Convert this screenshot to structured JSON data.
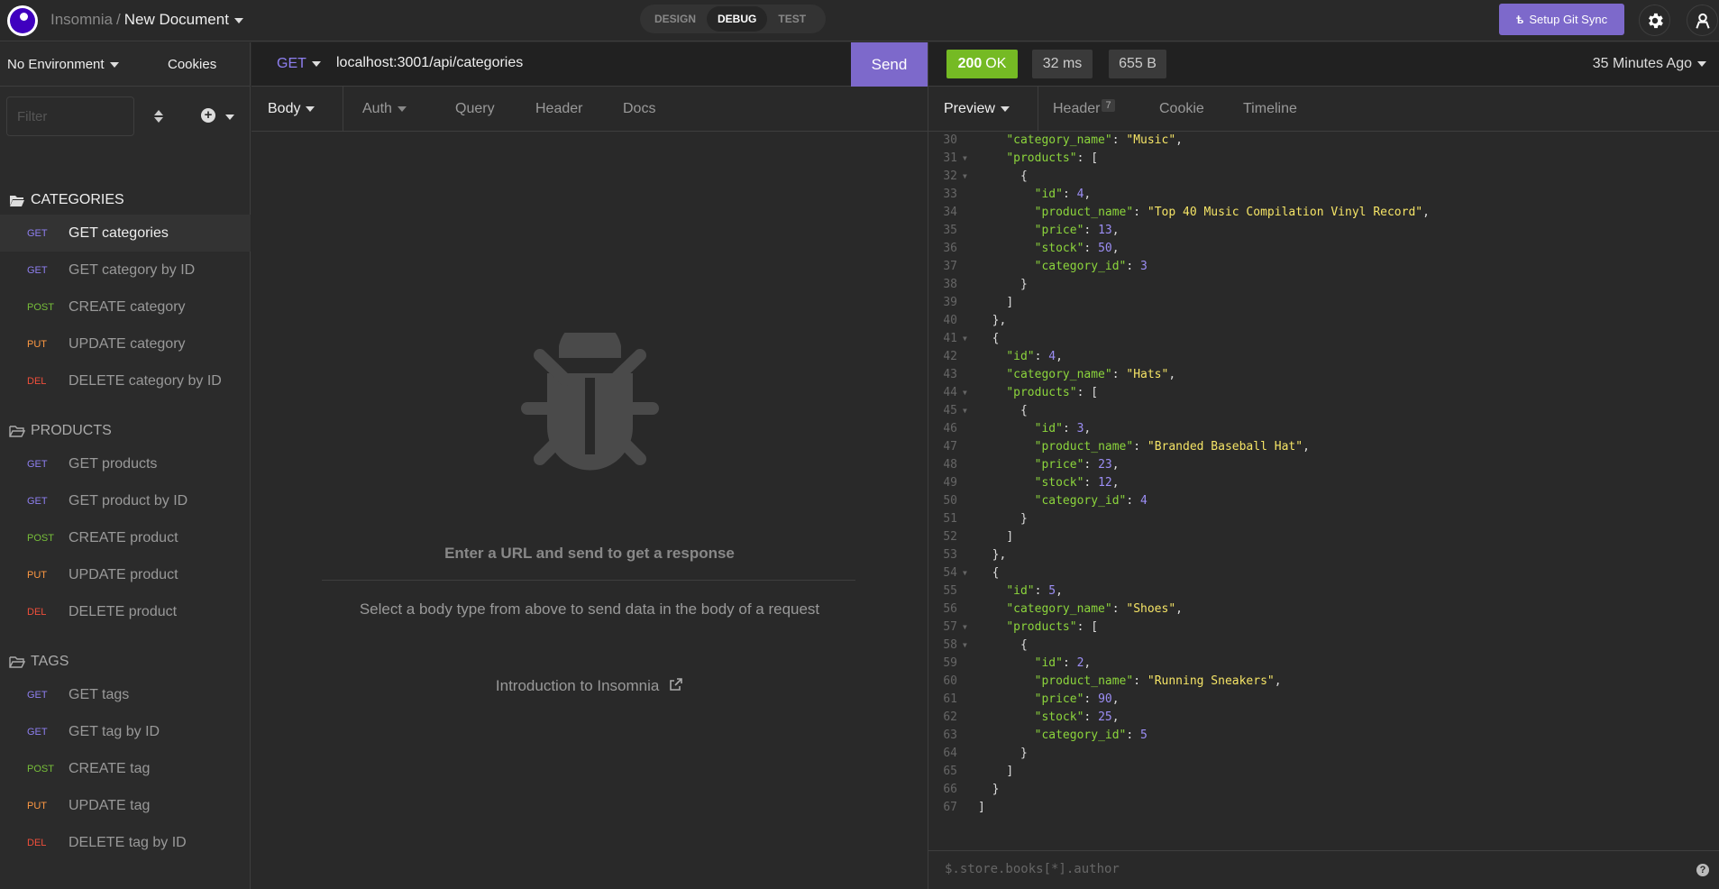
{
  "app": {
    "name": "Insomnia",
    "separator": "/",
    "document": "New Document",
    "modes": [
      "DESIGN",
      "DEBUG",
      "TEST"
    ],
    "active_mode": "DEBUG",
    "git_sync_label": "Setup Git Sync",
    "settings_icon": "gear-icon",
    "account_icon": "user-icon"
  },
  "sidebar": {
    "environment": "No Environment",
    "cookies_label": "Cookies",
    "filter_placeholder": "Filter",
    "folders": [
      {
        "name": "CATEGORIES",
        "open": true,
        "requests": [
          {
            "method": "GET",
            "name": "GET categories",
            "active": true
          },
          {
            "method": "GET",
            "name": "GET category by ID"
          },
          {
            "method": "POST",
            "name": "CREATE category"
          },
          {
            "method": "PUT",
            "name": "UPDATE category"
          },
          {
            "method": "DEL",
            "name": "DELETE category by ID"
          }
        ]
      },
      {
        "name": "PRODUCTS",
        "open": false,
        "requests": [
          {
            "method": "GET",
            "name": "GET products"
          },
          {
            "method": "GET",
            "name": "GET product by ID"
          },
          {
            "method": "POST",
            "name": "CREATE product"
          },
          {
            "method": "PUT",
            "name": "UPDATE product"
          },
          {
            "method": "DEL",
            "name": "DELETE product"
          }
        ]
      },
      {
        "name": "TAGS",
        "open": false,
        "requests": [
          {
            "method": "GET",
            "name": "GET tags"
          },
          {
            "method": "GET",
            "name": "GET tag by ID"
          },
          {
            "method": "POST",
            "name": "CREATE tag"
          },
          {
            "method": "PUT",
            "name": "UPDATE tag"
          },
          {
            "method": "DEL",
            "name": "DELETE tag by ID"
          }
        ]
      }
    ]
  },
  "request": {
    "method": "GET",
    "url": "localhost:3001/api/categories",
    "send_label": "Send",
    "tabs": [
      "Body",
      "Auth",
      "Query",
      "Header",
      "Docs"
    ],
    "empty_title": "Enter a URL and send to get a response",
    "empty_subtitle": "Select a body type from above to send data in the body of a request",
    "intro_link": "Introduction to Insomnia"
  },
  "response": {
    "status_code": "200",
    "status_text": "OK",
    "time": "32 ms",
    "size": "655 B",
    "age": "35 Minutes Ago",
    "tabs": [
      "Preview",
      "Header",
      "Cookie",
      "Timeline"
    ],
    "header_count": "7",
    "filter_placeholder": "$.store.books[*].author",
    "lines": [
      {
        "n": 30,
        "indent": 2,
        "key": "category_name",
        "str": "Music",
        "end": ","
      },
      {
        "n": 31,
        "indent": 2,
        "key": "products",
        "raw": "[",
        "fold": true
      },
      {
        "n": 32,
        "indent": 3,
        "raw": "{",
        "fold": true
      },
      {
        "n": 33,
        "indent": 4,
        "key": "id",
        "num": "4",
        "end": ","
      },
      {
        "n": 34,
        "indent": 4,
        "key": "product_name",
        "str": "Top 40 Music Compilation Vinyl Record",
        "end": ","
      },
      {
        "n": 35,
        "indent": 4,
        "key": "price",
        "num": "13",
        "end": ","
      },
      {
        "n": 36,
        "indent": 4,
        "key": "stock",
        "num": "50",
        "end": ","
      },
      {
        "n": 37,
        "indent": 4,
        "key": "category_id",
        "num": "3"
      },
      {
        "n": 38,
        "indent": 3,
        "raw": "}"
      },
      {
        "n": 39,
        "indent": 2,
        "raw": "]"
      },
      {
        "n": 40,
        "indent": 1,
        "raw": "},"
      },
      {
        "n": 41,
        "indent": 1,
        "raw": "{",
        "fold": true
      },
      {
        "n": 42,
        "indent": 2,
        "key": "id",
        "num": "4",
        "end": ","
      },
      {
        "n": 43,
        "indent": 2,
        "key": "category_name",
        "str": "Hats",
        "end": ","
      },
      {
        "n": 44,
        "indent": 2,
        "key": "products",
        "raw": "[",
        "fold": true
      },
      {
        "n": 45,
        "indent": 3,
        "raw": "{",
        "fold": true
      },
      {
        "n": 46,
        "indent": 4,
        "key": "id",
        "num": "3",
        "end": ","
      },
      {
        "n": 47,
        "indent": 4,
        "key": "product_name",
        "str": "Branded Baseball Hat",
        "end": ","
      },
      {
        "n": 48,
        "indent": 4,
        "key": "price",
        "num": "23",
        "end": ","
      },
      {
        "n": 49,
        "indent": 4,
        "key": "stock",
        "num": "12",
        "end": ","
      },
      {
        "n": 50,
        "indent": 4,
        "key": "category_id",
        "num": "4"
      },
      {
        "n": 51,
        "indent": 3,
        "raw": "}"
      },
      {
        "n": 52,
        "indent": 2,
        "raw": "]"
      },
      {
        "n": 53,
        "indent": 1,
        "raw": "},"
      },
      {
        "n": 54,
        "indent": 1,
        "raw": "{",
        "fold": true
      },
      {
        "n": 55,
        "indent": 2,
        "key": "id",
        "num": "5",
        "end": ","
      },
      {
        "n": 56,
        "indent": 2,
        "key": "category_name",
        "str": "Shoes",
        "end": ","
      },
      {
        "n": 57,
        "indent": 2,
        "key": "products",
        "raw": "[",
        "fold": true
      },
      {
        "n": 58,
        "indent": 3,
        "raw": "{",
        "fold": true
      },
      {
        "n": 59,
        "indent": 4,
        "key": "id",
        "num": "2",
        "end": ","
      },
      {
        "n": 60,
        "indent": 4,
        "key": "product_name",
        "str": "Running Sneakers",
        "end": ","
      },
      {
        "n": 61,
        "indent": 4,
        "key": "price",
        "num": "90",
        "end": ","
      },
      {
        "n": 62,
        "indent": 4,
        "key": "stock",
        "num": "25",
        "end": ","
      },
      {
        "n": 63,
        "indent": 4,
        "key": "category_id",
        "num": "5"
      },
      {
        "n": 64,
        "indent": 3,
        "raw": "}"
      },
      {
        "n": 65,
        "indent": 2,
        "raw": "]"
      },
      {
        "n": 66,
        "indent": 1,
        "raw": "}"
      },
      {
        "n": 67,
        "indent": 0,
        "raw": "]"
      }
    ]
  },
  "colors": {
    "accent": "#7d69cb",
    "status_ok": "#75ba24",
    "method_get": "#8e7ff0",
    "method_post": "#77bf3a",
    "method_put": "#ff9a43",
    "method_del": "#ef4f3b",
    "json_key": "#8cd53c",
    "json_string": "#f5e466",
    "json_number": "#9c8ef5"
  }
}
